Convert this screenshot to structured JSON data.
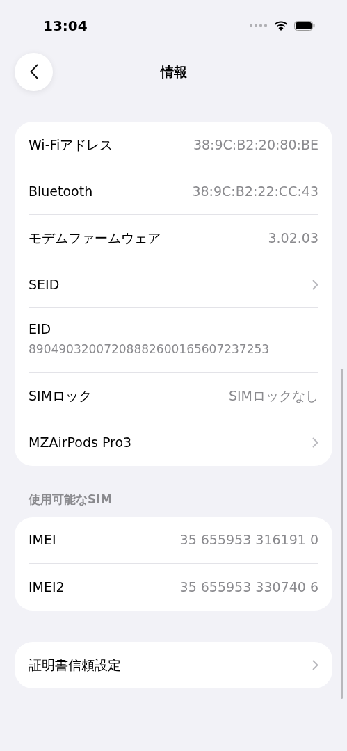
{
  "status_bar": {
    "time": "13:04"
  },
  "nav": {
    "title": "情報"
  },
  "groups": [
    {
      "rows": [
        {
          "kind": "value",
          "label": "Wi-Fiアドレス",
          "value": "38:9C:B2:20:80:BE"
        },
        {
          "kind": "value",
          "label": "Bluetooth",
          "value": "38:9C:B2:22:CC:43"
        },
        {
          "kind": "value",
          "label": "モデムファームウェア",
          "value": "3.02.03"
        },
        {
          "kind": "link",
          "label": "SEID"
        },
        {
          "kind": "stacked",
          "label": "EID",
          "value": "89049032007208882600165607237253"
        },
        {
          "kind": "value",
          "label": "SIMロック",
          "value": "SIMロックなし"
        },
        {
          "kind": "link",
          "label": "MZAirPods Pro3"
        }
      ]
    },
    {
      "header": "使用可能なSIM",
      "rows": [
        {
          "kind": "value",
          "label": "IMEI",
          "value": "35 655953 316191 0"
        },
        {
          "kind": "value",
          "label": "IMEI2",
          "value": "35 655953 330740 6"
        }
      ]
    },
    {
      "rows": [
        {
          "kind": "link",
          "label": "証明書信頼設定"
        }
      ]
    }
  ]
}
